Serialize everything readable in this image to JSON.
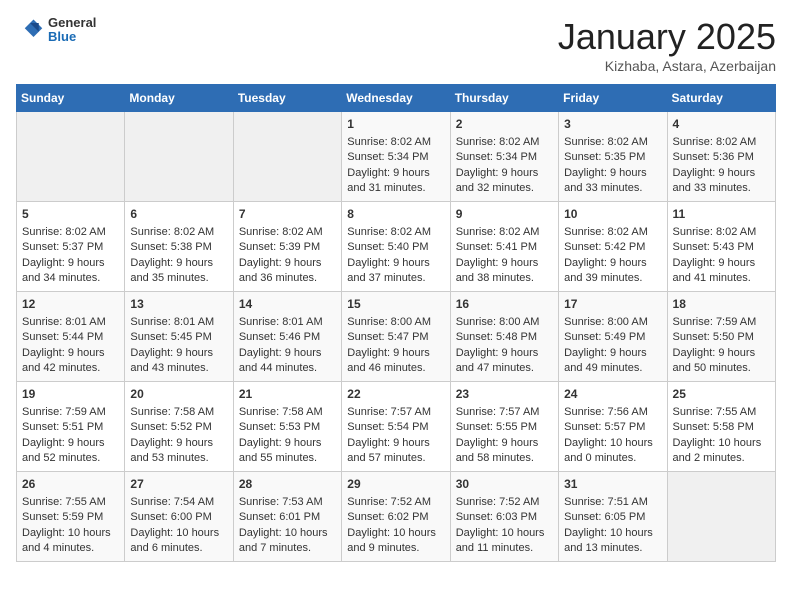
{
  "header": {
    "logo_general": "General",
    "logo_blue": "Blue",
    "title": "January 2025",
    "subtitle": "Kizhaba, Astara, Azerbaijan"
  },
  "days_of_week": [
    "Sunday",
    "Monday",
    "Tuesday",
    "Wednesday",
    "Thursday",
    "Friday",
    "Saturday"
  ],
  "weeks": [
    [
      {
        "num": "",
        "sunrise": "",
        "sunset": "",
        "daylight": "",
        "empty": true
      },
      {
        "num": "",
        "sunrise": "",
        "sunset": "",
        "daylight": "",
        "empty": true
      },
      {
        "num": "",
        "sunrise": "",
        "sunset": "",
        "daylight": "",
        "empty": true
      },
      {
        "num": "1",
        "sunrise": "Sunrise: 8:02 AM",
        "sunset": "Sunset: 5:34 PM",
        "daylight": "Daylight: 9 hours and 31 minutes."
      },
      {
        "num": "2",
        "sunrise": "Sunrise: 8:02 AM",
        "sunset": "Sunset: 5:34 PM",
        "daylight": "Daylight: 9 hours and 32 minutes."
      },
      {
        "num": "3",
        "sunrise": "Sunrise: 8:02 AM",
        "sunset": "Sunset: 5:35 PM",
        "daylight": "Daylight: 9 hours and 33 minutes."
      },
      {
        "num": "4",
        "sunrise": "Sunrise: 8:02 AM",
        "sunset": "Sunset: 5:36 PM",
        "daylight": "Daylight: 9 hours and 33 minutes."
      }
    ],
    [
      {
        "num": "5",
        "sunrise": "Sunrise: 8:02 AM",
        "sunset": "Sunset: 5:37 PM",
        "daylight": "Daylight: 9 hours and 34 minutes."
      },
      {
        "num": "6",
        "sunrise": "Sunrise: 8:02 AM",
        "sunset": "Sunset: 5:38 PM",
        "daylight": "Daylight: 9 hours and 35 minutes."
      },
      {
        "num": "7",
        "sunrise": "Sunrise: 8:02 AM",
        "sunset": "Sunset: 5:39 PM",
        "daylight": "Daylight: 9 hours and 36 minutes."
      },
      {
        "num": "8",
        "sunrise": "Sunrise: 8:02 AM",
        "sunset": "Sunset: 5:40 PM",
        "daylight": "Daylight: 9 hours and 37 minutes."
      },
      {
        "num": "9",
        "sunrise": "Sunrise: 8:02 AM",
        "sunset": "Sunset: 5:41 PM",
        "daylight": "Daylight: 9 hours and 38 minutes."
      },
      {
        "num": "10",
        "sunrise": "Sunrise: 8:02 AM",
        "sunset": "Sunset: 5:42 PM",
        "daylight": "Daylight: 9 hours and 39 minutes."
      },
      {
        "num": "11",
        "sunrise": "Sunrise: 8:02 AM",
        "sunset": "Sunset: 5:43 PM",
        "daylight": "Daylight: 9 hours and 41 minutes."
      }
    ],
    [
      {
        "num": "12",
        "sunrise": "Sunrise: 8:01 AM",
        "sunset": "Sunset: 5:44 PM",
        "daylight": "Daylight: 9 hours and 42 minutes."
      },
      {
        "num": "13",
        "sunrise": "Sunrise: 8:01 AM",
        "sunset": "Sunset: 5:45 PM",
        "daylight": "Daylight: 9 hours and 43 minutes."
      },
      {
        "num": "14",
        "sunrise": "Sunrise: 8:01 AM",
        "sunset": "Sunset: 5:46 PM",
        "daylight": "Daylight: 9 hours and 44 minutes."
      },
      {
        "num": "15",
        "sunrise": "Sunrise: 8:00 AM",
        "sunset": "Sunset: 5:47 PM",
        "daylight": "Daylight: 9 hours and 46 minutes."
      },
      {
        "num": "16",
        "sunrise": "Sunrise: 8:00 AM",
        "sunset": "Sunset: 5:48 PM",
        "daylight": "Daylight: 9 hours and 47 minutes."
      },
      {
        "num": "17",
        "sunrise": "Sunrise: 8:00 AM",
        "sunset": "Sunset: 5:49 PM",
        "daylight": "Daylight: 9 hours and 49 minutes."
      },
      {
        "num": "18",
        "sunrise": "Sunrise: 7:59 AM",
        "sunset": "Sunset: 5:50 PM",
        "daylight": "Daylight: 9 hours and 50 minutes."
      }
    ],
    [
      {
        "num": "19",
        "sunrise": "Sunrise: 7:59 AM",
        "sunset": "Sunset: 5:51 PM",
        "daylight": "Daylight: 9 hours and 52 minutes."
      },
      {
        "num": "20",
        "sunrise": "Sunrise: 7:58 AM",
        "sunset": "Sunset: 5:52 PM",
        "daylight": "Daylight: 9 hours and 53 minutes."
      },
      {
        "num": "21",
        "sunrise": "Sunrise: 7:58 AM",
        "sunset": "Sunset: 5:53 PM",
        "daylight": "Daylight: 9 hours and 55 minutes."
      },
      {
        "num": "22",
        "sunrise": "Sunrise: 7:57 AM",
        "sunset": "Sunset: 5:54 PM",
        "daylight": "Daylight: 9 hours and 57 minutes."
      },
      {
        "num": "23",
        "sunrise": "Sunrise: 7:57 AM",
        "sunset": "Sunset: 5:55 PM",
        "daylight": "Daylight: 9 hours and 58 minutes."
      },
      {
        "num": "24",
        "sunrise": "Sunrise: 7:56 AM",
        "sunset": "Sunset: 5:57 PM",
        "daylight": "Daylight: 10 hours and 0 minutes."
      },
      {
        "num": "25",
        "sunrise": "Sunrise: 7:55 AM",
        "sunset": "Sunset: 5:58 PM",
        "daylight": "Daylight: 10 hours and 2 minutes."
      }
    ],
    [
      {
        "num": "26",
        "sunrise": "Sunrise: 7:55 AM",
        "sunset": "Sunset: 5:59 PM",
        "daylight": "Daylight: 10 hours and 4 minutes."
      },
      {
        "num": "27",
        "sunrise": "Sunrise: 7:54 AM",
        "sunset": "Sunset: 6:00 PM",
        "daylight": "Daylight: 10 hours and 6 minutes."
      },
      {
        "num": "28",
        "sunrise": "Sunrise: 7:53 AM",
        "sunset": "Sunset: 6:01 PM",
        "daylight": "Daylight: 10 hours and 7 minutes."
      },
      {
        "num": "29",
        "sunrise": "Sunrise: 7:52 AM",
        "sunset": "Sunset: 6:02 PM",
        "daylight": "Daylight: 10 hours and 9 minutes."
      },
      {
        "num": "30",
        "sunrise": "Sunrise: 7:52 AM",
        "sunset": "Sunset: 6:03 PM",
        "daylight": "Daylight: 10 hours and 11 minutes."
      },
      {
        "num": "31",
        "sunrise": "Sunrise: 7:51 AM",
        "sunset": "Sunset: 6:05 PM",
        "daylight": "Daylight: 10 hours and 13 minutes."
      },
      {
        "num": "",
        "sunrise": "",
        "sunset": "",
        "daylight": "",
        "empty": true
      }
    ]
  ]
}
